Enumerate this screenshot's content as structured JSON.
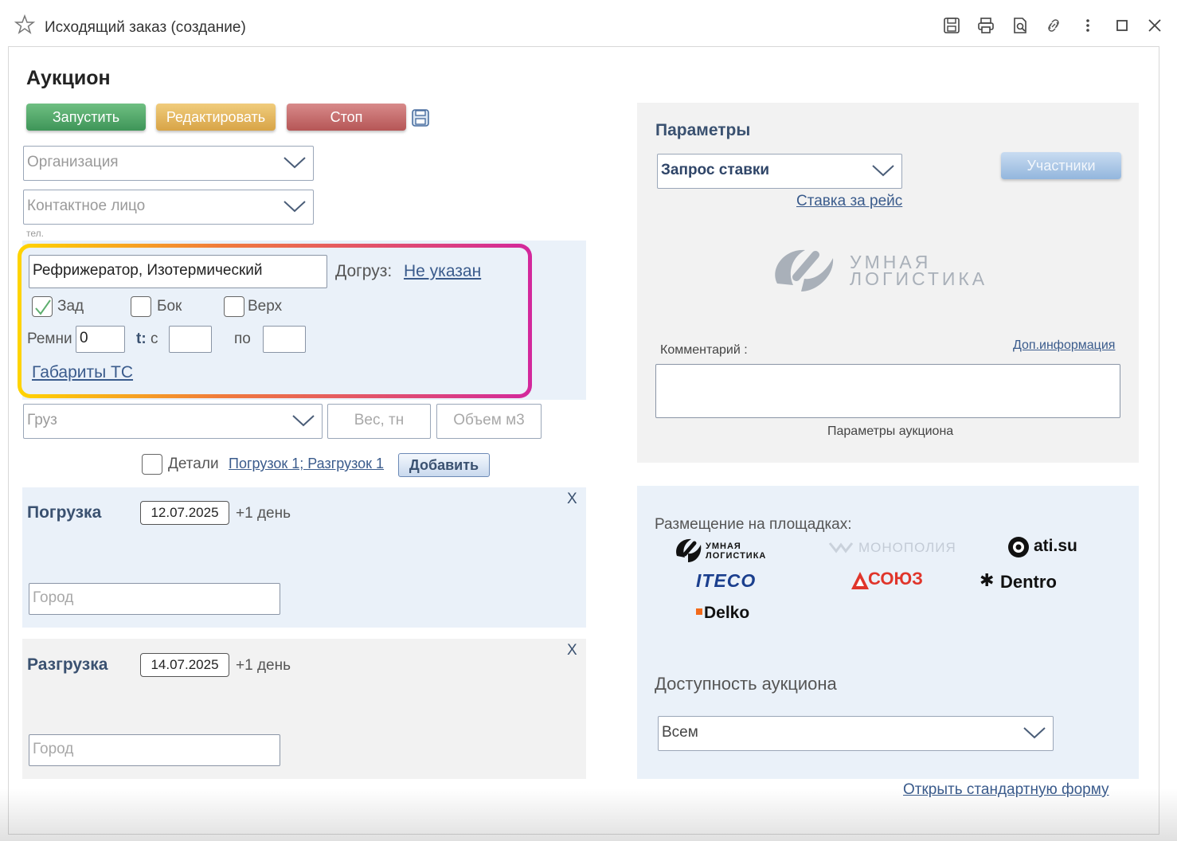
{
  "window": {
    "title": "Исходящий заказ (создание)"
  },
  "page": {
    "title": "Аукцион"
  },
  "actions": {
    "start": "Запустить",
    "edit": "Редактировать",
    "stop": "Стоп"
  },
  "form": {
    "organization_placeholder": "Организация",
    "contact_placeholder": "Контактное лицо",
    "phone_label": "тел.",
    "vehicle_type": "Рефрижератор, Изотермический",
    "extra_load_label": "Догруз:",
    "extra_load_value": "Не указан",
    "loading_back": "Зад",
    "loading_side": "Бок",
    "loading_top": "Верх",
    "straps_label": "Ремни",
    "straps_value": "0",
    "temp_label": "t:",
    "temp_from": "с",
    "temp_to": "по",
    "dimensions_link": "Габариты ТС",
    "cargo_placeholder": "Груз",
    "weight_placeholder": "Вес, тн",
    "volume_placeholder": "Объем м3",
    "details_label": "Детали",
    "details_link": "Погрузок 1; Разгрузок 1",
    "add_button": "Добавить"
  },
  "loading": {
    "title": "Погрузка",
    "date": "12.07.2025",
    "plus_day": "+1 день",
    "city_placeholder": "Город",
    "close": "X"
  },
  "unloading": {
    "title": "Разгрузка",
    "date": "14.07.2025",
    "plus_day": "+1 день",
    "city_placeholder": "Город",
    "close": "X"
  },
  "params": {
    "title": "Параметры",
    "bid_type": "Запрос ставки",
    "participants_button": "Участники",
    "rate_link": "Ставка за рейс",
    "logo_line1": "УМНАЯ",
    "logo_line2": "ЛОГИСТИКА",
    "comment_label": "Комментарий :",
    "extra_info_link": "Доп.информация",
    "auction_params": "Параметры аукциона"
  },
  "platforms": {
    "title": "Размещение на площадках:",
    "items": [
      {
        "name": "УМНАЯ ЛОГИСТИКА"
      },
      {
        "name": "МОНОПОЛИЯ"
      },
      {
        "name": "ati.su"
      },
      {
        "name": "ITECO"
      },
      {
        "name": "СОЮЗ"
      },
      {
        "name": "Dentro"
      },
      {
        "name": "Delko"
      }
    ]
  },
  "availability": {
    "title": "Доступность аукциона",
    "value": "Всем"
  },
  "footer": {
    "standard_form_link": "Открыть стандартную форму"
  },
  "colors": {
    "accent_blue": "#3a5170",
    "start": "#4fa866",
    "edit": "#e2b45c",
    "stop": "#c46a6a",
    "panel": "#eaf1f9"
  },
  "icons": [
    "star-icon",
    "save-icon",
    "print-icon",
    "preview-icon",
    "link-icon",
    "more-icon",
    "maximize-icon",
    "close-icon"
  ]
}
